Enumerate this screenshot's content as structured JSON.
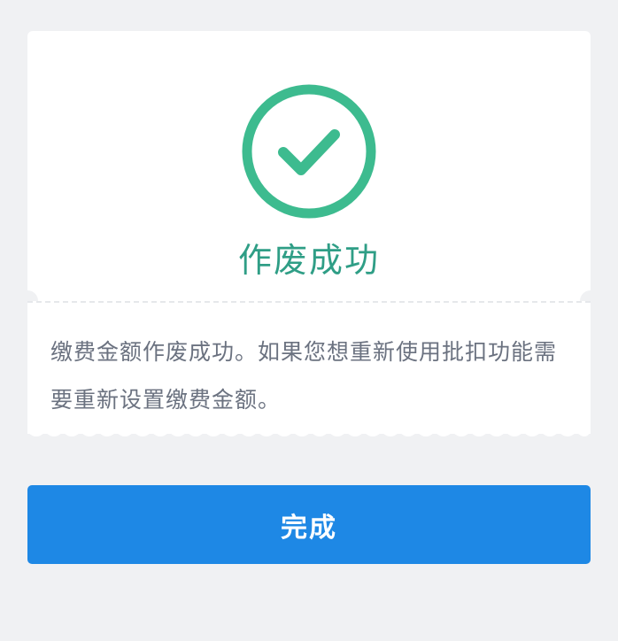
{
  "result": {
    "icon": "check-circle-icon",
    "title": "作废成功",
    "message": "缴费金额作废成功。如果您想重新使用批扣功能需要重新设置缴费金额。"
  },
  "actions": {
    "done_label": "完成"
  },
  "colors": {
    "success": "#3dbb8f",
    "title": "#2f9e86",
    "primary": "#1e88e5",
    "background": "#f0f1f3",
    "card": "#ffffff",
    "message": "#6b7280"
  }
}
